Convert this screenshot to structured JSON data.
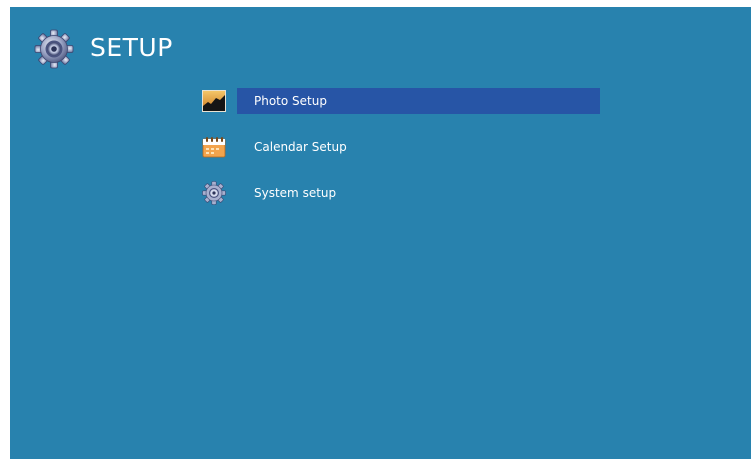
{
  "header": {
    "title": "SETUP",
    "icon": "gear-icon"
  },
  "menu": {
    "selected_index": 0,
    "items": [
      {
        "label": "Photo Setup",
        "icon": "photo-landscape-icon"
      },
      {
        "label": "Calendar Setup",
        "icon": "calendar-icon"
      },
      {
        "label": "System setup",
        "icon": "gear-icon"
      }
    ]
  },
  "colors": {
    "background": "#2882ae",
    "selection": "#2755a6",
    "text": "#ffffff"
  }
}
